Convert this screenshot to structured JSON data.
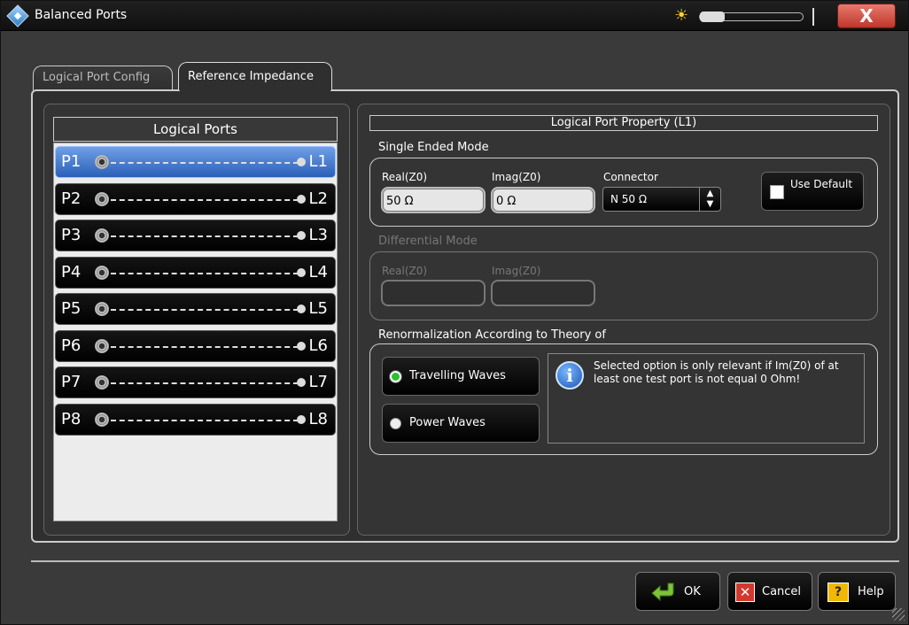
{
  "window": {
    "title": "Balanced Ports",
    "close_label": "X"
  },
  "tabs": [
    {
      "label": "Logical Port Config",
      "active": false
    },
    {
      "label": "Reference Impedance",
      "active": true
    }
  ],
  "logical_ports": {
    "header": "Logical Ports",
    "selected_index": 0,
    "rows": [
      {
        "physical": "P1",
        "logical": "L1"
      },
      {
        "physical": "P2",
        "logical": "L2"
      },
      {
        "physical": "P3",
        "logical": "L3"
      },
      {
        "physical": "P4",
        "logical": "L4"
      },
      {
        "physical": "P5",
        "logical": "L5"
      },
      {
        "physical": "P6",
        "logical": "L6"
      },
      {
        "physical": "P7",
        "logical": "L7"
      },
      {
        "physical": "P8",
        "logical": "L8"
      }
    ]
  },
  "property": {
    "header": "Logical Port Property (L1)",
    "single_ended": {
      "title": "Single Ended Mode",
      "real_label": "Real(Z0)",
      "real_value": "50 Ω",
      "imag_label": "Imag(Z0)",
      "imag_value": "0 Ω",
      "connector_label": "Connector",
      "connector_value": "N 50 Ω",
      "use_default_label": "Use Default",
      "use_default_checked": false
    },
    "differential": {
      "title": "Differential Mode",
      "real_label": "Real(Z0)",
      "imag_label": "Imag(Z0)",
      "enabled": false
    },
    "renormalization": {
      "title": "Renormalization According to Theory of",
      "options": [
        {
          "label": "Travelling Waves",
          "checked": true
        },
        {
          "label": "Power Waves",
          "checked": false
        }
      ],
      "info_text": "Selected option is only relevant if Im(Z0) of at least one test port is not equal 0 Ohm!"
    }
  },
  "buttons": {
    "ok": "OK",
    "cancel": "Cancel",
    "help": "Help"
  },
  "colors": {
    "selected_row": "#2a5fb8",
    "radio_checked": "#29c22e",
    "close_button": "#c0352a"
  },
  "icons": [
    "app-logo-icon",
    "sun-icon",
    "connector-icon",
    "info-icon",
    "ok-arrow-icon",
    "cancel-x-icon",
    "help-question-icon"
  ]
}
